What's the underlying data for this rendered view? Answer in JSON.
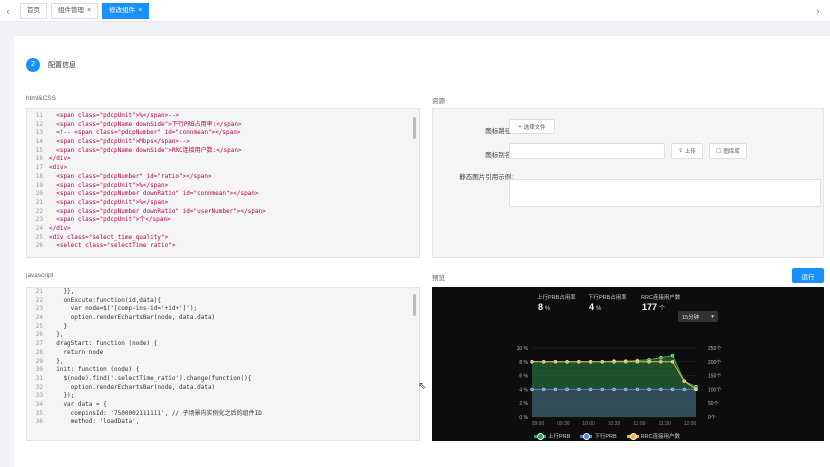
{
  "tabs": [
    {
      "label": "首页",
      "closable": false,
      "active": false
    },
    {
      "label": "组件管理",
      "closable": true,
      "active": false
    },
    {
      "label": "修改组件",
      "closable": true,
      "active": true
    }
  ],
  "step": {
    "number": "2",
    "label": "配置信息"
  },
  "html_css": {
    "title": "html&CSS",
    "lines": [
      {
        "n": "11",
        "t": "  <span class=\"pdcpUnit\">%</span>-->"
      },
      {
        "n": "12",
        "t": "  <span class=\"pdcpName downSide\">下行PRB占用率:</span>"
      },
      {
        "n": "13",
        "t": "  <!-- <span class=\"pdcpNumber\" id=\"connmean\"></span>"
      },
      {
        "n": "14",
        "t": "  <span class=\"pdcpUnit\">Mbps</span>-->"
      },
      {
        "n": "15",
        "t": "  <span class=\"pdcpName downSide\">RRC连接用户数:</span>"
      },
      {
        "n": "16",
        "t": "</div>"
      },
      {
        "n": "17",
        "t": "<div>"
      },
      {
        "n": "18",
        "t": "  <span class=\"pdcpNumber\" id=\"ratio\"></span>"
      },
      {
        "n": "19",
        "t": "  <span class=\"pdcpUnit\">%</span>"
      },
      {
        "n": "20",
        "t": "  <span class=\"pdcpNumber downRatio\" id=\"connmean\"></span>"
      },
      {
        "n": "21",
        "t": "  <span class=\"pdcpUnit\">%</span>"
      },
      {
        "n": "22",
        "t": "  <span class=\"pdcpNumber downRatio\" id=\"userNumber\"></span>"
      },
      {
        "n": "23",
        "t": "  <span class=\"pdcpUnit\">个</span>"
      },
      {
        "n": "24",
        "t": "</div>"
      },
      {
        "n": "25",
        "t": "<div class=\"select_time_quality\">"
      },
      {
        "n": "26",
        "t": "  <select class=\"selectTime ratio\">"
      }
    ]
  },
  "javascript": {
    "title": "javascript",
    "lines": [
      {
        "n": "21",
        "t": "    }},"
      },
      {
        "n": "22",
        "t": "    onExcute:function(id,data){"
      },
      {
        "n": "23",
        "t": "      var node=$('[comp-ins-id='+id+']');"
      },
      {
        "n": "24",
        "t": "      option.renderEchartsBar(node, data.data)"
      },
      {
        "n": "25",
        "t": "    }"
      },
      {
        "n": "26",
        "t": "  },"
      },
      {
        "n": "27",
        "t": "  dragStart: function (node) {"
      },
      {
        "n": "28",
        "t": "    return node"
      },
      {
        "n": "29",
        "t": "  },"
      },
      {
        "n": "30",
        "t": "  init: function (node) {"
      },
      {
        "n": "31",
        "t": "    $(node).find('.selectTime_ratio').change(function(){"
      },
      {
        "n": "32",
        "t": "      option.renderEchartsBar(node, data.data)"
      },
      {
        "n": "33",
        "t": "    });"
      },
      {
        "n": "34",
        "t": "    var data = {"
      },
      {
        "n": "35",
        "t": "      compinsId: '7500002111111', // 子场景内实例化之后的组件ID"
      },
      {
        "n": "36",
        "t": "      method: 'loadData',"
      }
    ]
  },
  "resource": {
    "title": "资源",
    "icon_path_label": "图标路径:",
    "choose_file": "选择文件",
    "icon_alias_label": "图标别名:",
    "upload": "上传",
    "icon_library": "图库库",
    "static_ref_label": "静态图片引用示例:"
  },
  "preview": {
    "title": "预览",
    "run": "运行"
  },
  "widget": {
    "kpis": [
      {
        "label": "上行PRB占用率",
        "value": "8",
        "unit": "%"
      },
      {
        "label": "下行PRB占用率",
        "value": "4",
        "unit": "%"
      },
      {
        "label": "RRC连接用户数",
        "value": "177",
        "unit": "个"
      }
    ],
    "select_value": "15分钟",
    "legend": [
      "上行PRB",
      "下行PRB",
      "RRC连接用户数"
    ]
  },
  "colors": {
    "accent": "#1890ff",
    "series_up": "#2ea44f",
    "series_down": "#5b7fd6",
    "series_rrc": "#f5b432"
  },
  "chart_data": {
    "type": "line",
    "x": [
      "09:00",
      "09:30",
      "10:00",
      "10:30",
      "11:00",
      "11:30",
      "12:00"
    ],
    "y_left": {
      "ticks": [
        "0 %",
        "2 %",
        "4 %",
        "6 %",
        "8 %",
        "10 %"
      ],
      "range": [
        0,
        10
      ]
    },
    "y_right": {
      "ticks": [
        "0个",
        "50个",
        "100个",
        "150个",
        "200个",
        "250个"
      ],
      "range": [
        0,
        250
      ]
    },
    "series": [
      {
        "name": "上行PRB",
        "axis": "left",
        "values": [
          8,
          8,
          8,
          8,
          8,
          8,
          8,
          8.1,
          8.1,
          8.2,
          8.3,
          8.6,
          8.9,
          5.2,
          4.4
        ]
      },
      {
        "name": "下行PRB",
        "axis": "left",
        "values": [
          4,
          4,
          4,
          4,
          4,
          4,
          4,
          4,
          4,
          4,
          4,
          4,
          4,
          4,
          4
        ]
      },
      {
        "name": "RRC连接用户数",
        "axis": "right",
        "values": [
          200,
          200,
          200,
          200,
          200,
          200,
          200,
          200,
          200,
          200,
          200,
          200,
          200,
          130,
          100
        ]
      }
    ]
  }
}
